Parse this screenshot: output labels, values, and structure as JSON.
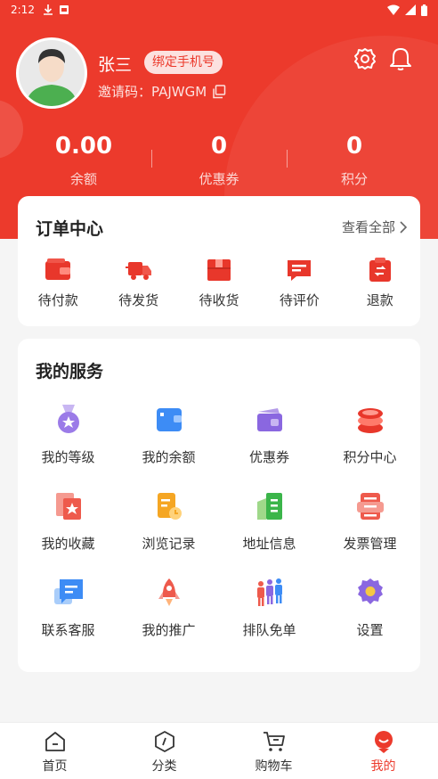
{
  "status_bar": {
    "time": "2:12"
  },
  "profile": {
    "name": "张三",
    "bind_phone_label": "绑定手机号",
    "invite_prefix": "邀请码：",
    "invite_code": "PAJWGM"
  },
  "stats": [
    {
      "value": "0.00",
      "label": "余额"
    },
    {
      "value": "0",
      "label": "优惠券"
    },
    {
      "value": "0",
      "label": "积分"
    }
  ],
  "orders": {
    "title": "订单中心",
    "view_all": "查看全部",
    "items": [
      {
        "label": "待付款",
        "icon": "wallet-icon"
      },
      {
        "label": "待发货",
        "icon": "truck-icon"
      },
      {
        "label": "待收货",
        "icon": "box-icon"
      },
      {
        "label": "待评价",
        "icon": "comment-icon"
      },
      {
        "label": "退款",
        "icon": "refund-icon"
      }
    ]
  },
  "services": {
    "title": "我的服务",
    "items": [
      {
        "label": "我的等级",
        "icon": "medal-icon"
      },
      {
        "label": "我的余额",
        "icon": "balance-icon"
      },
      {
        "label": "优惠券",
        "icon": "coupon-icon"
      },
      {
        "label": "积分中心",
        "icon": "coins-icon"
      },
      {
        "label": "我的收藏",
        "icon": "favorites-icon"
      },
      {
        "label": "浏览记录",
        "icon": "history-icon"
      },
      {
        "label": "地址信息",
        "icon": "address-icon"
      },
      {
        "label": "发票管理",
        "icon": "invoice-icon"
      },
      {
        "label": "联系客服",
        "icon": "chat-icon"
      },
      {
        "label": "我的推广",
        "icon": "rocket-icon"
      },
      {
        "label": "排队免单",
        "icon": "queue-icon"
      },
      {
        "label": "设置",
        "icon": "settings-gear-icon"
      }
    ]
  },
  "nav": [
    {
      "label": "首页",
      "icon": "home-icon"
    },
    {
      "label": "分类",
      "icon": "category-icon"
    },
    {
      "label": "购物车",
      "icon": "cart-icon"
    },
    {
      "label": "我的",
      "icon": "profile-icon",
      "active": true
    }
  ],
  "colors": {
    "accent": "#ec3a2c",
    "page_bg": "#f5f5f5"
  }
}
